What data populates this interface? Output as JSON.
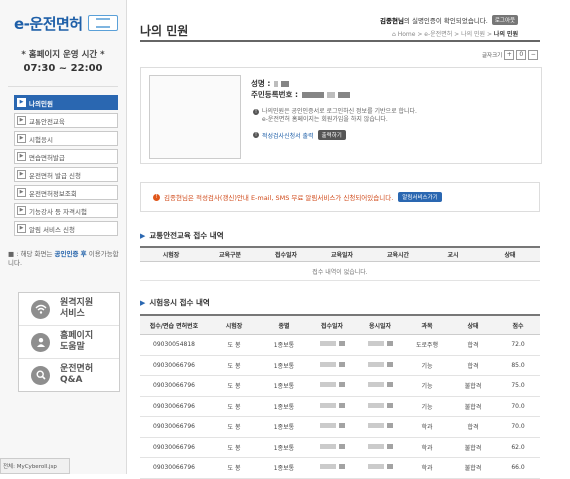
{
  "sidebar": {
    "logo_text": "e-운전면허",
    "hours_label": "* 홈페이지 운영 시간 *",
    "hours_value": "07:30 ~ 22:00",
    "menu": [
      {
        "label": "나의민원",
        "active": true
      },
      {
        "label": "교통안전교육",
        "active": false
      },
      {
        "label": "시험응시",
        "active": false
      },
      {
        "label": "면습면허발급",
        "active": false
      },
      {
        "label": "운전면허 발급 신청",
        "active": false
      },
      {
        "label": "운전면허정보조회",
        "active": false
      },
      {
        "label": "기능강사 등 자격시험",
        "active": false
      },
      {
        "label": "알림 서비스 신청",
        "active": false
      }
    ],
    "note_prefix": "■ : 해당 화면는 ",
    "note_highlight": "공인인증 후",
    "note_suffix": "이용가능합니다.",
    "quick_links": [
      {
        "icon": "remote-support-icon",
        "label_line1": "원격지원",
        "label_line2": "서비스"
      },
      {
        "icon": "help-icon",
        "label_line1": "홈페이지",
        "label_line2": "도움말"
      },
      {
        "icon": "qa-icon",
        "label_line1": "운전면허",
        "label_line2": "Q&A"
      }
    ],
    "status_text": "전체: MyCyberoll.jsp"
  },
  "header": {
    "page_title": "나의 민원",
    "welcome_name": "김종현님",
    "welcome_text": "의 실명인증이 확인되었습니다.",
    "logout_label": "로그아웃",
    "breadcrumb": [
      "Home",
      "e-운전면허",
      "나의 민원"
    ],
    "breadcrumb_current": "나의 민원",
    "textsize_label": "글자크기",
    "textsize_buttons": [
      "+",
      "0",
      "−"
    ]
  },
  "profile": {
    "name_label": "성명 :",
    "id_label": "주민등록번호 :",
    "note1": "나의민원은 공인인증서로 로그인하신 정보를 기반으로 합니다.",
    "note2": "e-운전면허 홈페이지는 회원가입을 하지 않습니다.",
    "print_label": "적성검사신청서 출력",
    "print_button": "출력하기"
  },
  "alert": {
    "text": "김종현님은 적성검사(갱신)안내 E-mail, SMS 무료 알림서비스가 신청되어있습니다.",
    "button": "알림서비스가기"
  },
  "education": {
    "title": "교통안전교육 접수 내역",
    "columns": [
      "시험장",
      "교육구분",
      "접수일자",
      "교육일자",
      "교육시간",
      "교시",
      "상태"
    ],
    "empty_text": "접수 내역이 없습니다."
  },
  "exam": {
    "title": "시험응시 접수 내역",
    "columns": [
      "접수/면습 면허번호",
      "시험장",
      "종별",
      "접수일자",
      "응시일자",
      "과목",
      "상태",
      "점수"
    ],
    "rows": [
      {
        "no": "09030054818",
        "site": "도 봉",
        "type": "1종보통",
        "subject": "도로주행",
        "status": "합격",
        "score": "72.0"
      },
      {
        "no": "09030066796",
        "site": "도 봉",
        "type": "1종보통",
        "subject": "기능",
        "status": "합격",
        "score": "85.0"
      },
      {
        "no": "09030066796",
        "site": "도 봉",
        "type": "1종보통",
        "subject": "기능",
        "status": "불합격",
        "score": "75.0"
      },
      {
        "no": "09030066796",
        "site": "도 봉",
        "type": "1종보통",
        "subject": "기능",
        "status": "불합격",
        "score": "70.0"
      },
      {
        "no": "09030066796",
        "site": "도 봉",
        "type": "1종보통",
        "subject": "학과",
        "status": "합격",
        "score": "70.0"
      },
      {
        "no": "09030066796",
        "site": "도 봉",
        "type": "1종보통",
        "subject": "학과",
        "status": "불합격",
        "score": "62.0"
      },
      {
        "no": "09030066796",
        "site": "도 봉",
        "type": "1종보통",
        "subject": "학과",
        "status": "불합격",
        "score": "66.0"
      }
    ]
  }
}
